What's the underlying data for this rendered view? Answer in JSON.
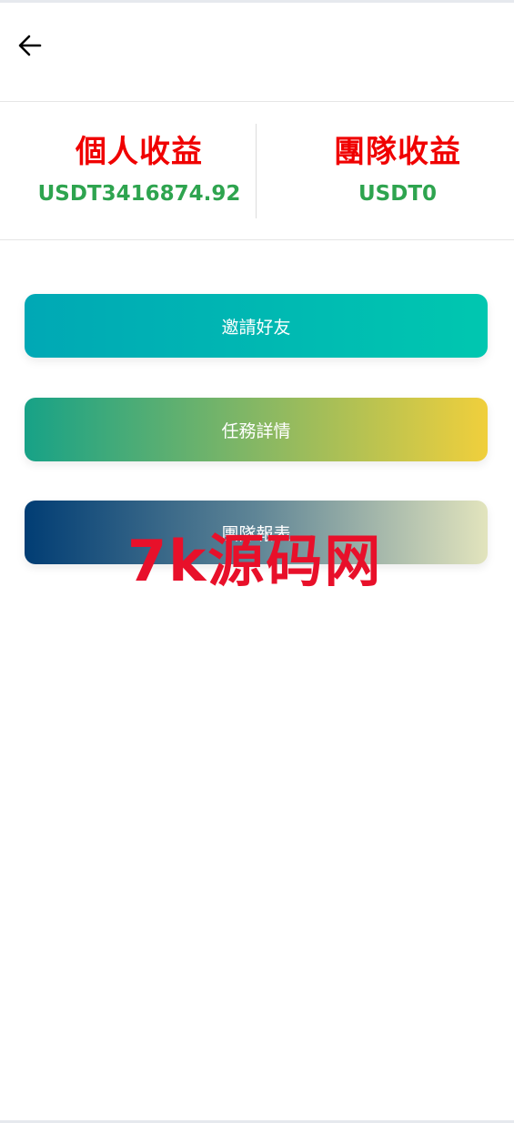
{
  "header": {
    "back_icon": "arrow-left-icon"
  },
  "stats": {
    "personal": {
      "title": "個人收益",
      "value": "USDT3416874.92"
    },
    "team": {
      "title": "團隊收益",
      "value": "USDT0"
    }
  },
  "actions": {
    "invite_label": "邀請好友",
    "task_label": "任務詳情",
    "report_label": "團隊報表"
  },
  "watermark": {
    "text": "7k源码网"
  },
  "colors": {
    "title_red": "#f00000",
    "value_green": "#2ea44f",
    "invite_gradient": [
      "#00a8b5",
      "#00c7b0"
    ],
    "task_gradient": [
      "#17a287",
      "#f0cf3c"
    ],
    "report_gradient": [
      "#013d74",
      "#e2e4bd"
    ],
    "watermark_red": "#e8102a"
  }
}
